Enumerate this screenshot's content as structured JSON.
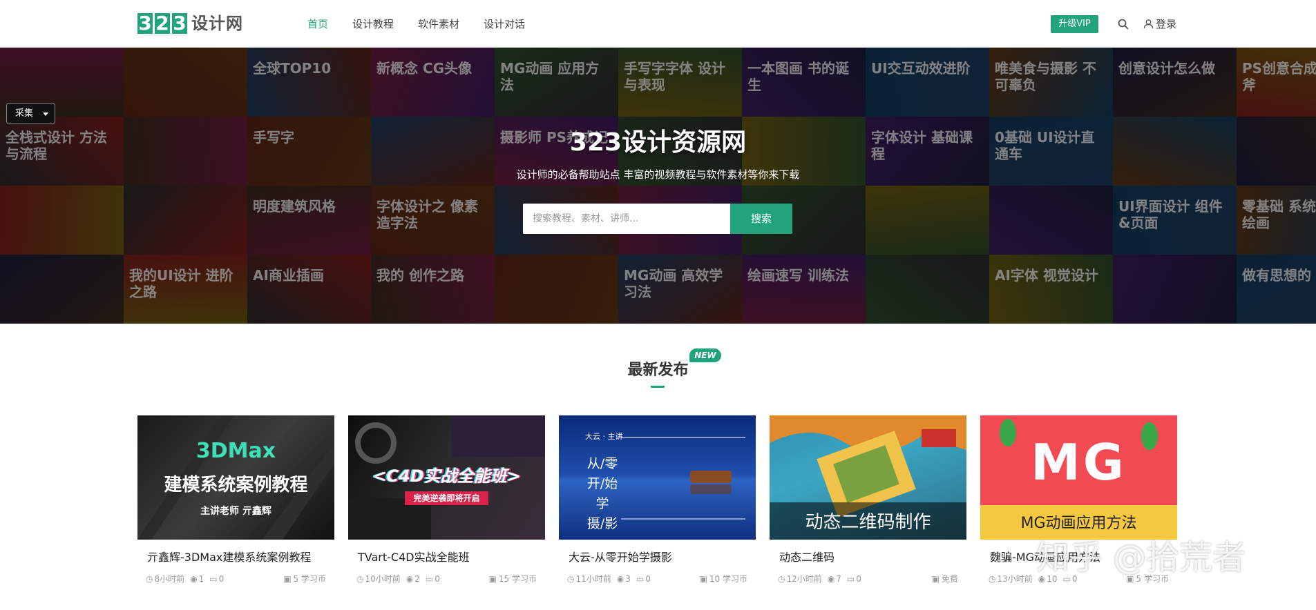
{
  "header": {
    "logo_mark": [
      "3",
      "2",
      "3"
    ],
    "logo_text": "设计网",
    "nav": [
      {
        "label": "首页",
        "active": true
      },
      {
        "label": "设计教程",
        "active": false
      },
      {
        "label": "软件素材",
        "active": false
      },
      {
        "label": "设计对话",
        "active": false
      }
    ],
    "vip_label": "升级VIP",
    "login_label": "登录"
  },
  "banner": {
    "collect_label": "采集",
    "title": "323设计资源网",
    "subtitle": "设计师的必备帮助站点 丰富的视频教程与软件素材等你来下载",
    "search_placeholder": "搜索教程、素材、讲师...",
    "search_button": "搜索",
    "tile_texts": [
      "",
      "",
      "全球TOP10",
      "新概念 CG头像",
      "MG动画 应用方法",
      "手写字字体 设计与表现",
      "一本图画 书的诞生",
      "UI交互动效进阶",
      "唯美食与摄影 不可辜负",
      "创意设计怎么做",
      "PS创意合成 三板斧",
      "全栈式设计 方法与流程",
      "",
      "手写字",
      "",
      "摄影师 PS养成记",
      "",
      "",
      "字体设计 基础课程",
      "0基础 UI设计直通车",
      "",
      "",
      "",
      "",
      "明度建筑风格",
      "字体设计之 像素造字法",
      "",
      "",
      "",
      "",
      "",
      "UI界面设计 组件&页面",
      "零基础 系统学CG绘画",
      "",
      "我的UI设计 进阶之路",
      "AI商业插画",
      "我的 创作之路",
      "",
      "MG动画 高效学习法",
      "绘画速写 训练法",
      "",
      "AI字体 视觉设计",
      "",
      "做有思想的 设计"
    ]
  },
  "section": {
    "title": "最新发布",
    "badge": "NEW"
  },
  "cards": [
    {
      "thumb_line1": "3DMax",
      "thumb_line2": "建模系统案例教程",
      "thumb_line3": "主讲老师 亓鑫辉",
      "title": "亓鑫辉-3DMax建模系统案例教程",
      "time": "8小时前",
      "views": "1",
      "comments": "0",
      "price": "5 学习币"
    },
    {
      "thumb_line1": "<C4D实战全能班>",
      "thumb_line2": "完美逆袭即将开启",
      "title": "TVart-C4D实战全能班",
      "time": "10小时前",
      "views": "2",
      "comments": "0",
      "price": "15 学习币"
    },
    {
      "thumb_line1": "大云 · 主讲",
      "thumb_line2": "从/零 开/始 学 摄/影",
      "title": "大云-从零开始学摄影",
      "time": "11小时前",
      "views": "3",
      "comments": "0",
      "price": "10 学习币"
    },
    {
      "thumb_line1": "动态二维码制作",
      "title": "动态二维码",
      "time": "12小时前",
      "views": "7",
      "comments": "0",
      "price": "免费"
    },
    {
      "thumb_line1": "MG",
      "thumb_line2": "MG动画应用方法",
      "title": "魏骗-MG动画应用方法",
      "time": "13小时前",
      "views": "10",
      "comments": "0",
      "price": "5 学习币"
    }
  ],
  "watermark": "知乎 @拾荒者",
  "colors": {
    "accent": "#21a47b",
    "tile_palette": [
      "#3a2a1c",
      "#5a2418",
      "#1e3a5c",
      "#6a1c3c",
      "#2c4a2a",
      "#6c5a10",
      "#3c1c5c",
      "#143c5a",
      "#5c3414",
      "#1c1c3c",
      "#7c1c1c",
      "#2a2a2a"
    ]
  }
}
